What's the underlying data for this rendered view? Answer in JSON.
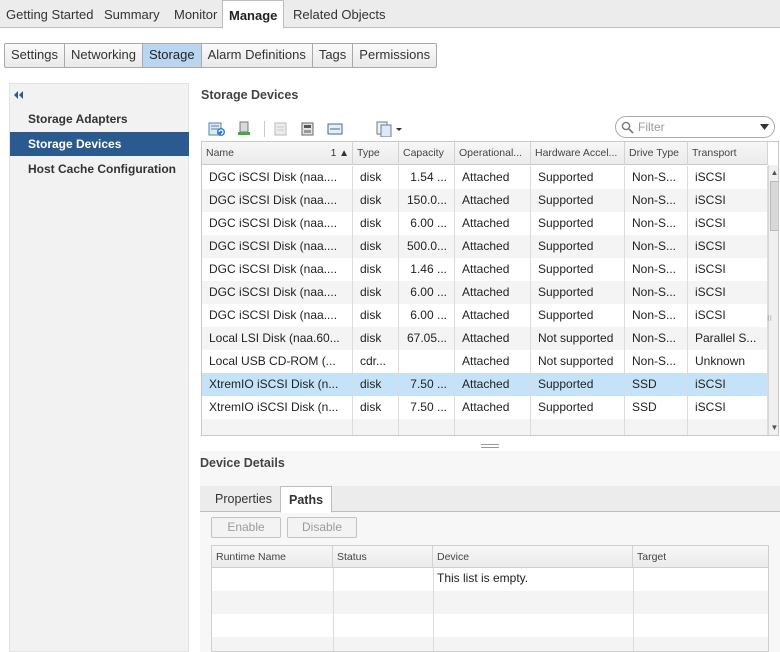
{
  "top_tabs": [
    "Getting Started",
    "Summary",
    "Monitor",
    "Manage",
    "Related Objects"
  ],
  "sub_tabs": [
    "Settings",
    "Networking",
    "Storage",
    "Alarm Definitions",
    "Tags",
    "Permissions"
  ],
  "nav": {
    "items": [
      "Storage Adapters",
      "Storage Devices",
      "Host Cache Configuration"
    ]
  },
  "storage_devices": {
    "title": "Storage Devices",
    "filter_placeholder": "Filter",
    "columns": [
      "Name",
      "Type",
      "Capacity",
      "Operational...",
      "Hardware Accel...",
      "Drive Type",
      "Transport"
    ],
    "sort_indicator": "1 ▲",
    "rows": [
      [
        "DGC iSCSI Disk (naa....",
        "disk",
        "1.54 ...",
        "Attached",
        "Supported",
        "Non-S...",
        "iSCSI"
      ],
      [
        "DGC iSCSI Disk (naa....",
        "disk",
        "150.0...",
        "Attached",
        "Supported",
        "Non-S...",
        "iSCSI"
      ],
      [
        "DGC iSCSI Disk (naa....",
        "disk",
        "6.00 ...",
        "Attached",
        "Supported",
        "Non-S...",
        "iSCSI"
      ],
      [
        "DGC iSCSI Disk (naa....",
        "disk",
        "500.0...",
        "Attached",
        "Supported",
        "Non-S...",
        "iSCSI"
      ],
      [
        "DGC iSCSI Disk (naa....",
        "disk",
        "1.46 ...",
        "Attached",
        "Supported",
        "Non-S...",
        "iSCSI"
      ],
      [
        "DGC iSCSI Disk (naa....",
        "disk",
        "6.00 ...",
        "Attached",
        "Supported",
        "Non-S...",
        "iSCSI"
      ],
      [
        "DGC iSCSI Disk (naa....",
        "disk",
        "6.00 ...",
        "Attached",
        "Supported",
        "Non-S...",
        "iSCSI"
      ],
      [
        "Local LSI Disk (naa.60...",
        "disk",
        "67.05...",
        "Attached",
        "Not supported",
        "Non-S...",
        "Parallel S..."
      ],
      [
        "Local USB CD-ROM (...",
        "cdr...",
        "",
        "Attached",
        "Not supported",
        "Non-S...",
        "Unknown"
      ],
      [
        "XtremIO iSCSI Disk (n...",
        "disk",
        "7.50 ...",
        "Attached",
        "Supported",
        "SSD",
        "iSCSI"
      ],
      [
        "XtremIO iSCSI Disk (n...",
        "disk",
        "7.50 ...",
        "Attached",
        "Supported",
        "SSD",
        "iSCSI"
      ]
    ]
  },
  "device_details": {
    "title": "Device Details",
    "tabs": [
      "Properties",
      "Paths"
    ],
    "buttons": {
      "enable": "Enable",
      "disable": "Disable"
    },
    "path_columns": [
      "Runtime Name",
      "Status",
      "Device",
      "Target"
    ],
    "empty_message": "This list is empty."
  },
  "colors": {
    "selection": "#c4e3f8",
    "nav_active": "#2b5a8e",
    "subtab_active": "#b9d6f1"
  }
}
